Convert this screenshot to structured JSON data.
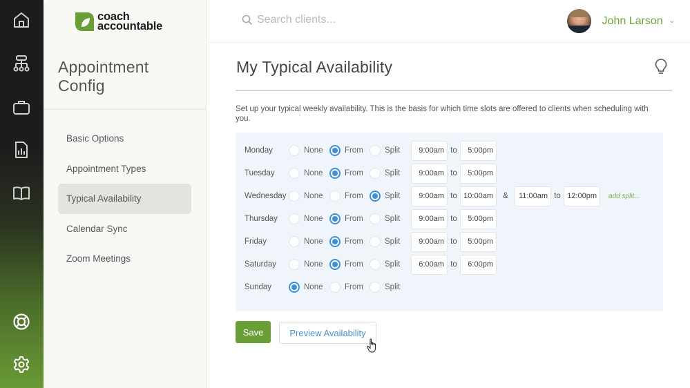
{
  "app": {
    "brand_line1": "coach",
    "brand_line2": "accountable",
    "brand_color": "#6a9e36"
  },
  "rail": {
    "icons": [
      {
        "name": "home-icon"
      },
      {
        "name": "org-chart-icon"
      },
      {
        "name": "briefcase-icon"
      },
      {
        "name": "report-icon"
      },
      {
        "name": "book-icon"
      },
      {
        "name": "lifebuoy-icon"
      },
      {
        "name": "gear-icon"
      }
    ]
  },
  "sidebar": {
    "title_line1": "Appointment",
    "title_line2": "Config",
    "items": [
      {
        "label": "Basic Options",
        "active": false
      },
      {
        "label": "Appointment Types",
        "active": false
      },
      {
        "label": "Typical Availability",
        "active": true
      },
      {
        "label": "Calendar Sync",
        "active": false
      },
      {
        "label": "Zoom Meetings",
        "active": false
      }
    ]
  },
  "header": {
    "search_placeholder": "Search clients...",
    "search_value": "",
    "user_name": "John Larson",
    "accent_color": "#6da33d"
  },
  "main": {
    "title": "My Typical Availability",
    "description": "Set up your typical weekly availability. This is the basis for which time slots are offered to clients when scheduling with you.",
    "option_labels": {
      "none": "None",
      "from": "From",
      "split": "Split"
    },
    "to_label": "to",
    "amp_label": "&",
    "add_split_label": "add split...",
    "days": [
      {
        "day": "Monday",
        "mode": "from",
        "start": "9:00am",
        "end": "5:00pm"
      },
      {
        "day": "Tuesday",
        "mode": "from",
        "start": "9:00am",
        "end": "5:00pm"
      },
      {
        "day": "Wednesday",
        "mode": "split",
        "start": "9:00am",
        "end": "10:00am",
        "start2": "11:00am",
        "end2": "12:00pm"
      },
      {
        "day": "Thursday",
        "mode": "from",
        "start": "9:00am",
        "end": "5:00pm"
      },
      {
        "day": "Friday",
        "mode": "from",
        "start": "9:00am",
        "end": "5:00pm"
      },
      {
        "day": "Saturday",
        "mode": "from",
        "start": "6:00am",
        "end": "6:00pm"
      },
      {
        "day": "Sunday",
        "mode": "none"
      }
    ],
    "save_label": "Save",
    "preview_label": "Preview Availability",
    "radio_color": "#3d8fd6"
  }
}
